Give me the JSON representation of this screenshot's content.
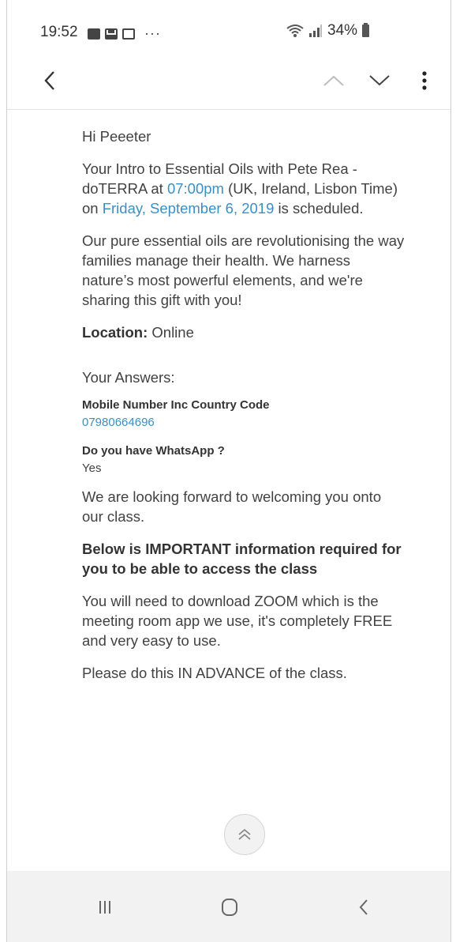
{
  "status_bar": {
    "time": "19:52",
    "dots": "···",
    "battery": "34%",
    "icons": [
      "image-icon",
      "mail-icon",
      "message-icon",
      "wifi-icon",
      "signal-icon",
      "battery-icon"
    ]
  },
  "toolbar": {
    "icons": [
      "back-arrow-icon",
      "chevron-up-icon",
      "chevron-down-icon",
      "more-vert-icon"
    ]
  },
  "email": {
    "greeting": "Hi Peeeter",
    "p1_a": "Your Intro to Essential Oils with Pete Rea - doTERRA at ",
    "p1_time": "07:00pm",
    "p1_b": " (UK, Ireland, Lisbon Time) on ",
    "p1_date": "Friday, September 6, 2019",
    "p1_c": " is scheduled.",
    "p2": "Our pure essential oils are revolutionising the way families manage their health. We harness nature’s most powerful elements, and we're sharing this gift with you!",
    "location_label": "Location:",
    "location_value": " Online",
    "answers_heading": "Your Answers:",
    "q1_label": "Mobile Number Inc Country Code",
    "q1_value": "07980664696",
    "q2_label": "Do you have WhatsApp ?",
    "q2_value": "Yes",
    "p3": "We are looking forward to welcoming you onto our class.",
    "p4": "Below is IMPORTANT information required for you to be able to access the class",
    "p5": "You will need to download ZOOM which is the meeting room app we use, it's completely FREE and very easy to use.",
    "p6": "Please do this IN ADVANCE of the class."
  },
  "colors": {
    "link": "#3a8fc4",
    "text": "#424242",
    "navbar": "#f2f2f2"
  }
}
